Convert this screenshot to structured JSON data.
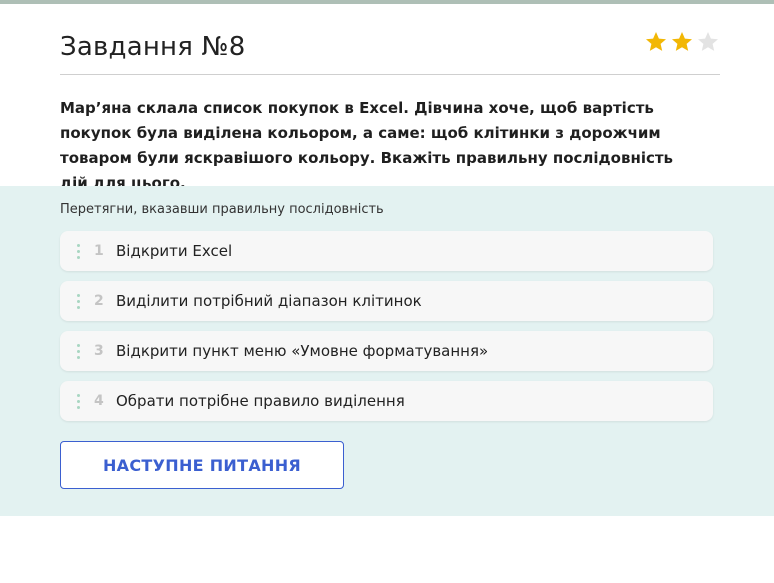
{
  "task": {
    "title": "Завдання №8",
    "rating": {
      "filled": 2,
      "total": 3
    },
    "question": "Мар’яна склала список покупок в Excel. Дівчина хоче, щоб вартість покупок була виділена кольором, а саме: щоб клітинки з дорожчим товаром були яскравішого кольору. Вкажіть правильну послідовність дій для цього."
  },
  "answer": {
    "hint": "Перетягни, вказавши правильну послідовність",
    "items": [
      {
        "number": "1",
        "label": "Відкрити Excel"
      },
      {
        "number": "2",
        "label": "Виділити потрібний діапазон клітинок"
      },
      {
        "number": "3",
        "label": "Відкрити пункт меню «Умовне форматування»"
      },
      {
        "number": "4",
        "label": "Обрати потрібне правило виділення"
      }
    ],
    "next_button": "НАСТУПНЕ ПИТАННЯ"
  },
  "colors": {
    "accent": "#3b5fd0",
    "star_filled": "#f2b705",
    "star_empty": "#e3e3e3",
    "answer_bg": "#e3f2f1"
  },
  "icons": {
    "star": "star-icon",
    "drag": "drag-handle-icon"
  }
}
